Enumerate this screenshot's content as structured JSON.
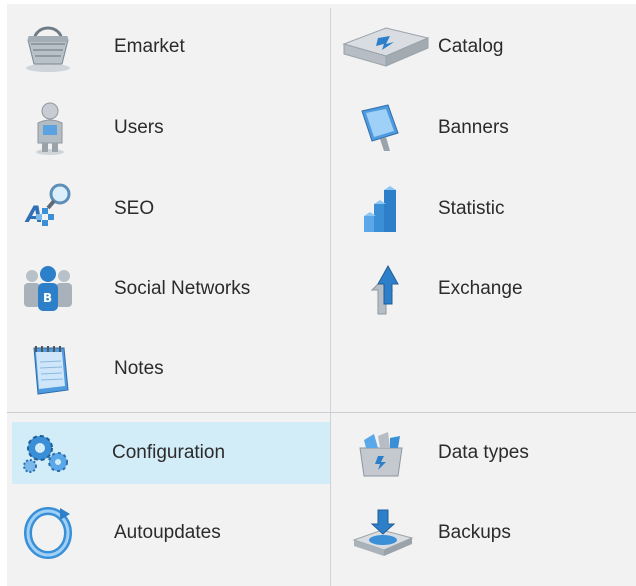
{
  "sections": {
    "top": {
      "left": [
        {
          "key": "emarket",
          "label": "Emarket",
          "icon": "shopping-basket-icon"
        },
        {
          "key": "users",
          "label": "Users",
          "icon": "user-figure-icon"
        },
        {
          "key": "seo",
          "label": "SEO",
          "icon": "seo-magnifier-icon"
        },
        {
          "key": "social",
          "label": "Social Networks",
          "icon": "social-people-icon"
        },
        {
          "key": "notes",
          "label": "Notes",
          "icon": "notepad-icon"
        }
      ],
      "right": [
        {
          "key": "catalog",
          "label": "Catalog",
          "icon": "catalog-box-icon"
        },
        {
          "key": "banners",
          "label": "Banners",
          "icon": "banner-icon"
        },
        {
          "key": "statistic",
          "label": "Statistic",
          "icon": "stats-bars-icon"
        },
        {
          "key": "exchange",
          "label": "Exchange",
          "icon": "exchange-arrows-icon"
        }
      ]
    },
    "bottom": {
      "left": [
        {
          "key": "configuration",
          "label": "Configuration",
          "icon": "gears-icon",
          "active": true
        },
        {
          "key": "autoupdates",
          "label": "Autoupdates",
          "icon": "refresh-ring-icon"
        }
      ],
      "right": [
        {
          "key": "datatypes",
          "label": "Data types",
          "icon": "data-types-box-icon"
        },
        {
          "key": "backups",
          "label": "Backups",
          "icon": "backup-tray-icon"
        }
      ]
    }
  },
  "colors": {
    "panel_bg": "#f2f2f2",
    "active_bg": "#d2ecf8",
    "divider": "#cfd3d7",
    "label": "#2b2b2b",
    "icon_blue": "#3a8fd6"
  }
}
